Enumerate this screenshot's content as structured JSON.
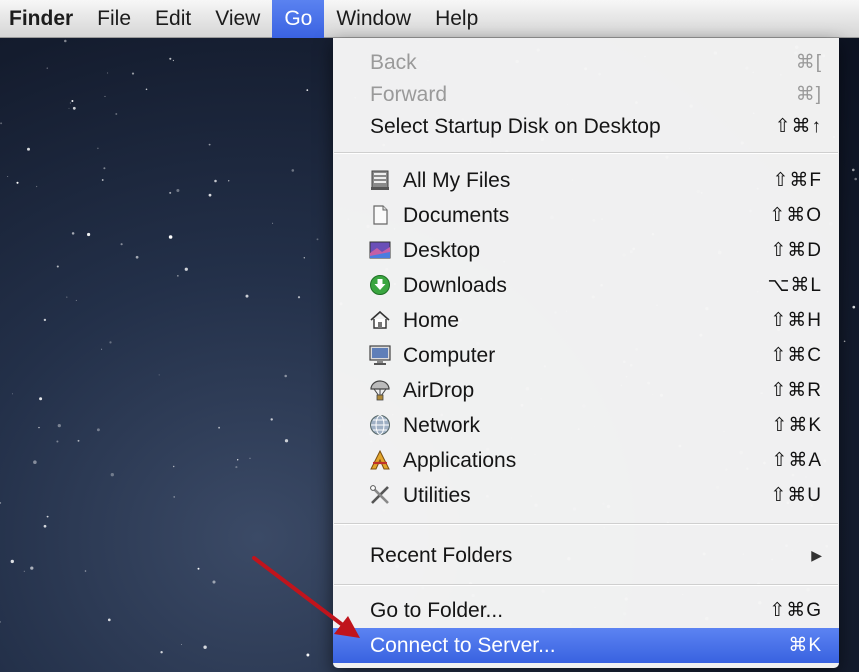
{
  "menubar": {
    "items": [
      {
        "label": "Finder"
      },
      {
        "label": "File"
      },
      {
        "label": "Edit"
      },
      {
        "label": "View"
      },
      {
        "label": "Go"
      },
      {
        "label": "Window"
      },
      {
        "label": "Help"
      }
    ]
  },
  "go_menu": {
    "back": {
      "label": "Back",
      "shortcut": "⌘["
    },
    "forward": {
      "label": "Forward",
      "shortcut": "⌘]"
    },
    "startup_disk": {
      "label": "Select Startup Disk on Desktop",
      "shortcut": "⇧⌘↑"
    },
    "all_my_files": {
      "label": "All My Files",
      "shortcut": "⇧⌘F",
      "icon": "all-my-files-icon"
    },
    "documents": {
      "label": "Documents",
      "shortcut": "⇧⌘O",
      "icon": "documents-icon"
    },
    "desktop": {
      "label": "Desktop",
      "shortcut": "⇧⌘D",
      "icon": "desktop-icon"
    },
    "downloads": {
      "label": "Downloads",
      "shortcut": "⌥⌘L",
      "icon": "downloads-icon"
    },
    "home": {
      "label": "Home",
      "shortcut": "⇧⌘H",
      "icon": "home-icon"
    },
    "computer": {
      "label": "Computer",
      "shortcut": "⇧⌘C",
      "icon": "computer-icon"
    },
    "airdrop": {
      "label": "AirDrop",
      "shortcut": "⇧⌘R",
      "icon": "airdrop-icon"
    },
    "network": {
      "label": "Network",
      "shortcut": "⇧⌘K",
      "icon": "network-icon"
    },
    "applications": {
      "label": "Applications",
      "shortcut": "⇧⌘A",
      "icon": "applications-icon"
    },
    "utilities": {
      "label": "Utilities",
      "shortcut": "⇧⌘U",
      "icon": "utilities-icon"
    },
    "recent_folders": {
      "label": "Recent Folders",
      "submenu_indicator": "▶"
    },
    "go_to_folder": {
      "label": "Go to Folder...",
      "shortcut": "⇧⌘G"
    },
    "connect_to_server": {
      "label": "Connect to Server...",
      "shortcut": "⌘K"
    }
  },
  "colors": {
    "highlight": "#3a62e2",
    "annotation_arrow": "#c0141c"
  }
}
